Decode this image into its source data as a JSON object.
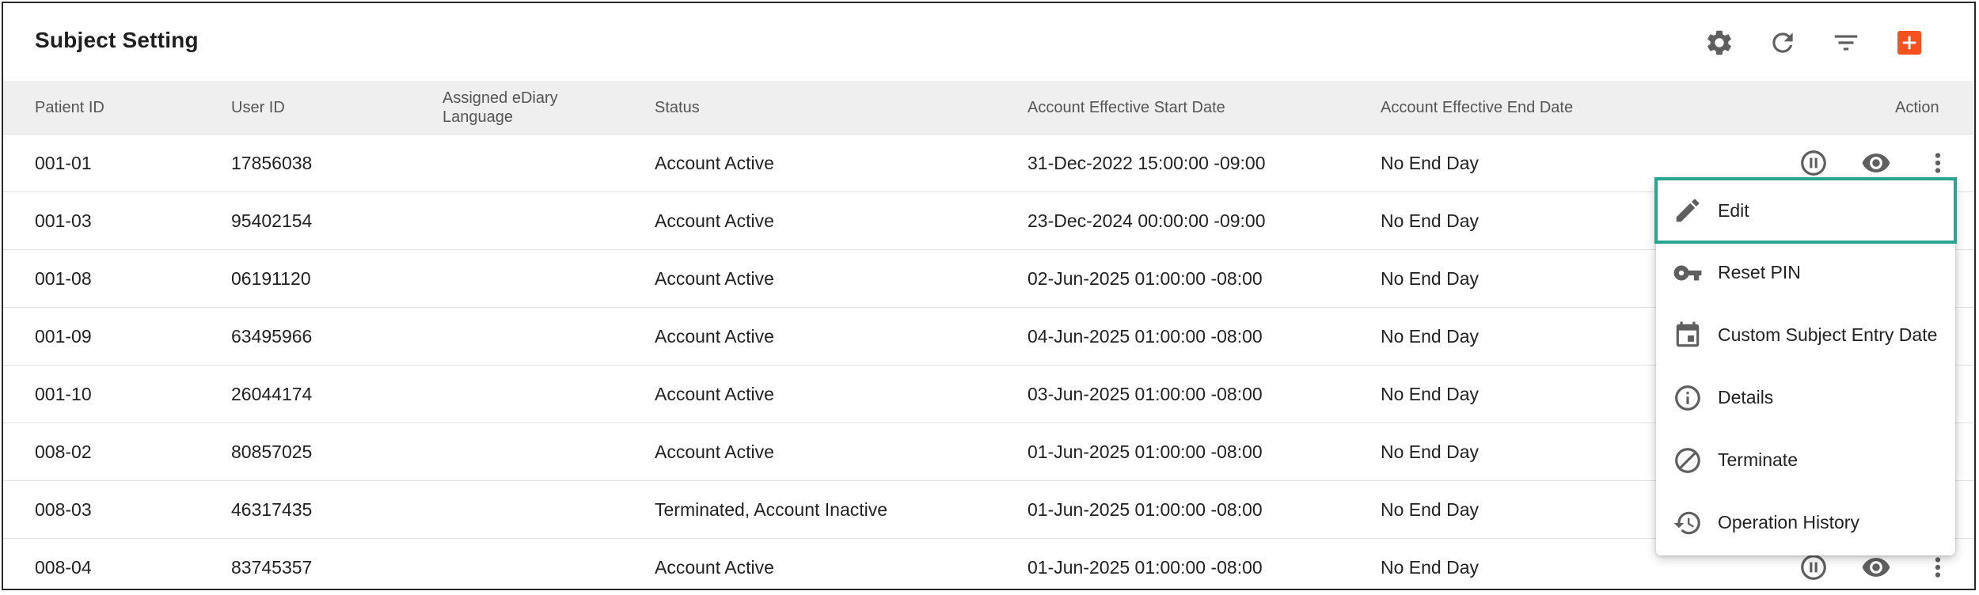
{
  "header": {
    "title": "Subject Setting",
    "tools": [
      {
        "name": "settings",
        "icon": "gear-icon"
      },
      {
        "name": "refresh",
        "icon": "refresh-icon"
      },
      {
        "name": "filter",
        "icon": "filter-icon"
      },
      {
        "name": "add",
        "icon": "add-box-icon",
        "color": "#f4511e"
      }
    ]
  },
  "table": {
    "columns": {
      "patient_id": "Patient ID",
      "user_id": "User ID",
      "language": "Assigned eDiary Language",
      "status": "Status",
      "start_date": "Account Effective Start Date",
      "end_date": "Account Effective End Date",
      "action": "Action"
    },
    "rows": [
      {
        "patient_id": "001-01",
        "user_id": "17856038",
        "language": "",
        "status": "Account Active",
        "start_date": "31-Dec-2022 15:00:00 -09:00",
        "end_date": "No End Day"
      },
      {
        "patient_id": "001-03",
        "user_id": "95402154",
        "language": "",
        "status": "Account Active",
        "start_date": "23-Dec-2024 00:00:00 -09:00",
        "end_date": "No End Day"
      },
      {
        "patient_id": "001-08",
        "user_id": "06191120",
        "language": "",
        "status": "Account Active",
        "start_date": "02-Jun-2025 01:00:00 -08:00",
        "end_date": "No End Day"
      },
      {
        "patient_id": "001-09",
        "user_id": "63495966",
        "language": "",
        "status": "Account Active",
        "start_date": "04-Jun-2025 01:00:00 -08:00",
        "end_date": "No End Day"
      },
      {
        "patient_id": "001-10",
        "user_id": "26044174",
        "language": "",
        "status": "Account Active",
        "start_date": "03-Jun-2025 01:00:00 -08:00",
        "end_date": "No End Day"
      },
      {
        "patient_id": "008-02",
        "user_id": "80857025",
        "language": "",
        "status": "Account Active",
        "start_date": "01-Jun-2025 01:00:00 -08:00",
        "end_date": "No End Day"
      },
      {
        "patient_id": "008-03",
        "user_id": "46317435",
        "language": "",
        "status": "Terminated, Account Inactive",
        "start_date": "01-Jun-2025 01:00:00 -08:00",
        "end_date": "No End Day"
      },
      {
        "patient_id": "008-04",
        "user_id": "83745357",
        "language": "",
        "status": "Account Active",
        "start_date": "01-Jun-2025 01:00:00 -08:00",
        "end_date": "No End Day"
      }
    ]
  },
  "row_actions": [
    "pause-icon",
    "eye-icon",
    "more-vertical-icon"
  ],
  "action_menu": {
    "items": [
      {
        "label": "Edit",
        "icon": "pencil-icon",
        "focused": true
      },
      {
        "label": "Reset PIN",
        "icon": "key-icon"
      },
      {
        "label": "Custom Subject Entry Date",
        "icon": "calendar-icon"
      },
      {
        "label": "Details",
        "icon": "info-icon"
      },
      {
        "label": "Terminate",
        "icon": "block-icon"
      },
      {
        "label": "Operation History",
        "icon": "history-icon"
      }
    ],
    "focus_color": "#2aa58f"
  }
}
